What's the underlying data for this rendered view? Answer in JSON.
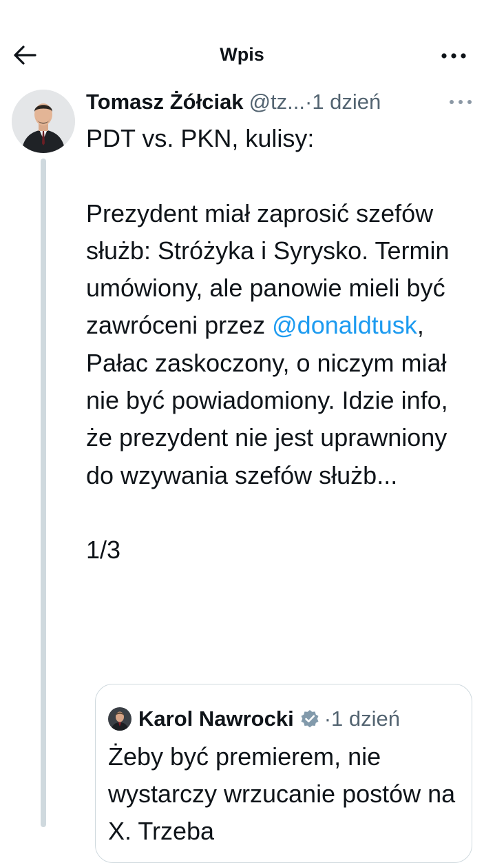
{
  "header": {
    "title": "Wpis",
    "back_icon": "arrow-left-icon",
    "more_icon": "more-horizontal-icon"
  },
  "tweet": {
    "author_name": "Tomasz Żółciak",
    "handle": "@tz...",
    "separator": "·",
    "time": "1 dzień",
    "more_icon": "more-horizontal-icon",
    "body": {
      "line1": "PDT vs. PKN, kulisy:",
      "para2_before": "Prezydent miał zaprosić szefów służb: Stróżyka i Syrysko. Termin umówiony, ale panowie mieli być zawróceni przez",
      "mention": "@donaldtusk",
      "para2_after": ", Pałac zaskoczony, o niczym miał nie być powiadomiony. Idzie info, że prezydent nie jest uprawniony do wzywania szefów służb...",
      "counter": "1/3"
    }
  },
  "quote": {
    "author_name": "Karol Nawrocki",
    "verified_icon": "verified-badge-icon",
    "separator": "·",
    "time": "1 dzień",
    "body": "Żeby być premierem, nie wystarczy wrzucanie postów na X. Trzeba"
  },
  "colors": {
    "text": "#0f1419",
    "secondary": "#536471",
    "link": "#1d9bf0",
    "thread_line": "#cfd9de",
    "border": "#cfd9de"
  }
}
